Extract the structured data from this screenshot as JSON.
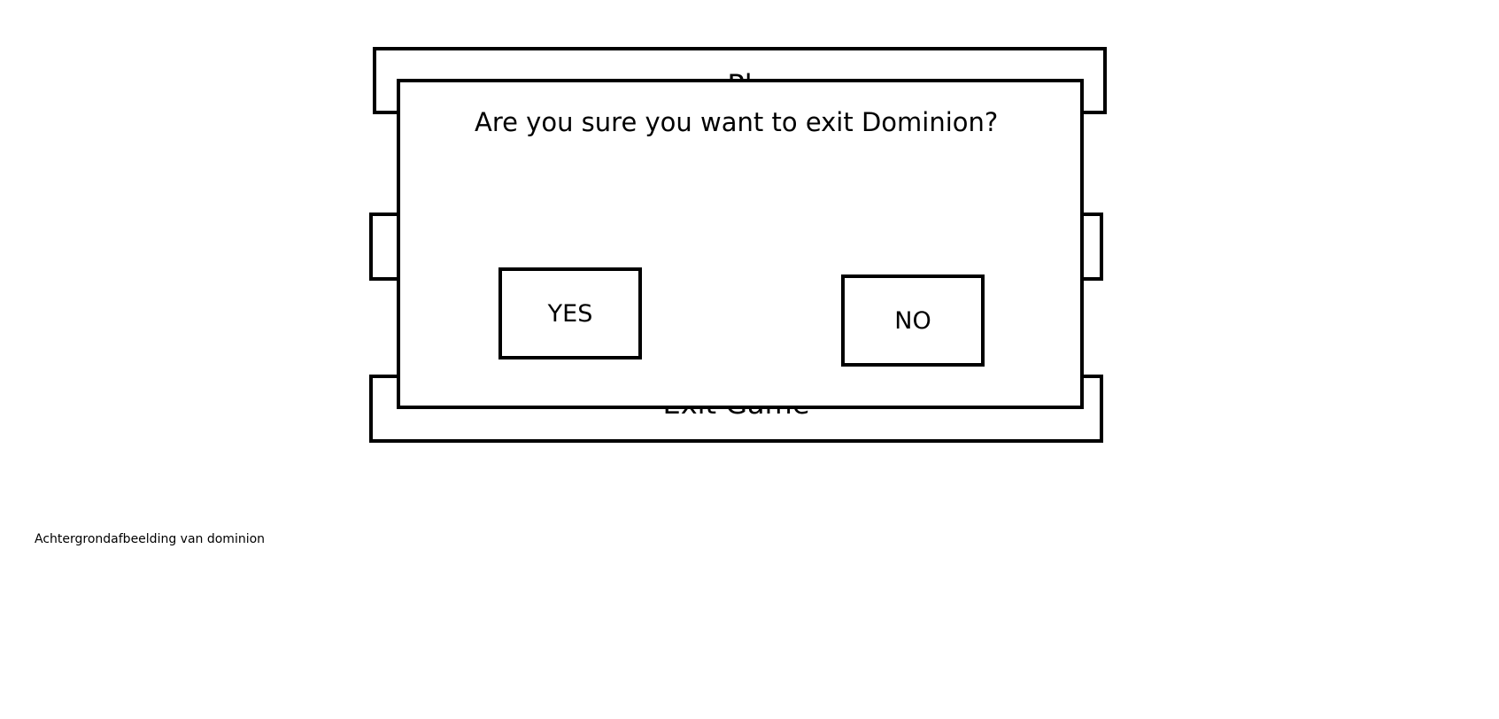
{
  "menu": {
    "play_label": "Pl",
    "middle_label": "",
    "exit_label": "Exit Game"
  },
  "dialog": {
    "message": "Are you sure you want to exit Dominion?",
    "yes_label": "YES",
    "no_label": "NO"
  },
  "background": {
    "caption": "Achtergrondafbeelding van dominion"
  }
}
